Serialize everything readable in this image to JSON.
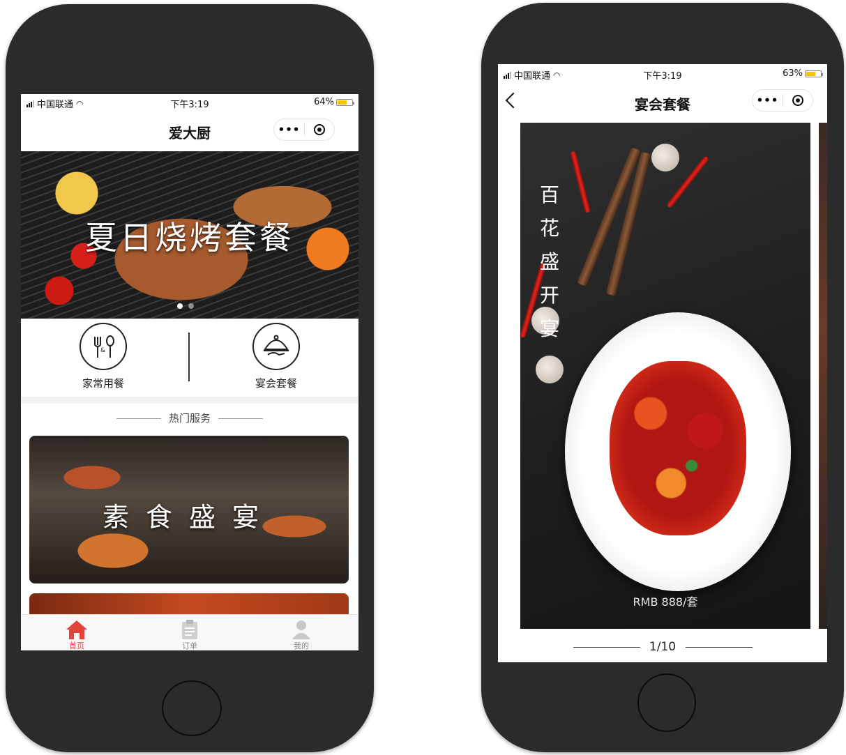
{
  "phone1": {
    "status": {
      "carrier": "中国联通",
      "time": "下午3:19",
      "battery": "64%"
    },
    "nav_title": "爱大厨",
    "capsule": {
      "more": "•••"
    },
    "banner": {
      "title": "夏日烧烤套餐",
      "dot_count": 2,
      "active_dot": 1
    },
    "categories": [
      {
        "label": "家常用餐",
        "icon": "fork-spoon-icon"
      },
      {
        "label": "宴会套餐",
        "icon": "cloche-icon"
      }
    ],
    "section_title": "热门服务",
    "cards": [
      {
        "title": "素食盛宴"
      }
    ],
    "tabs": [
      {
        "label": "首页",
        "icon": "home-icon",
        "active": true
      },
      {
        "label": "订单",
        "icon": "clipboard-icon",
        "active": false
      },
      {
        "label": "我的",
        "icon": "user-icon",
        "active": false
      }
    ],
    "colors": {
      "accent": "#e0443a",
      "battery": "#f5c400"
    }
  },
  "phone2": {
    "status": {
      "carrier": "中国联通",
      "time": "下午3:19",
      "battery": "63%"
    },
    "nav_title": "宴会套餐",
    "capsule": {
      "more": "•••"
    },
    "slide": {
      "title": "百花盛开宴",
      "price": "RMB 888/套"
    },
    "pager": "1/10"
  }
}
